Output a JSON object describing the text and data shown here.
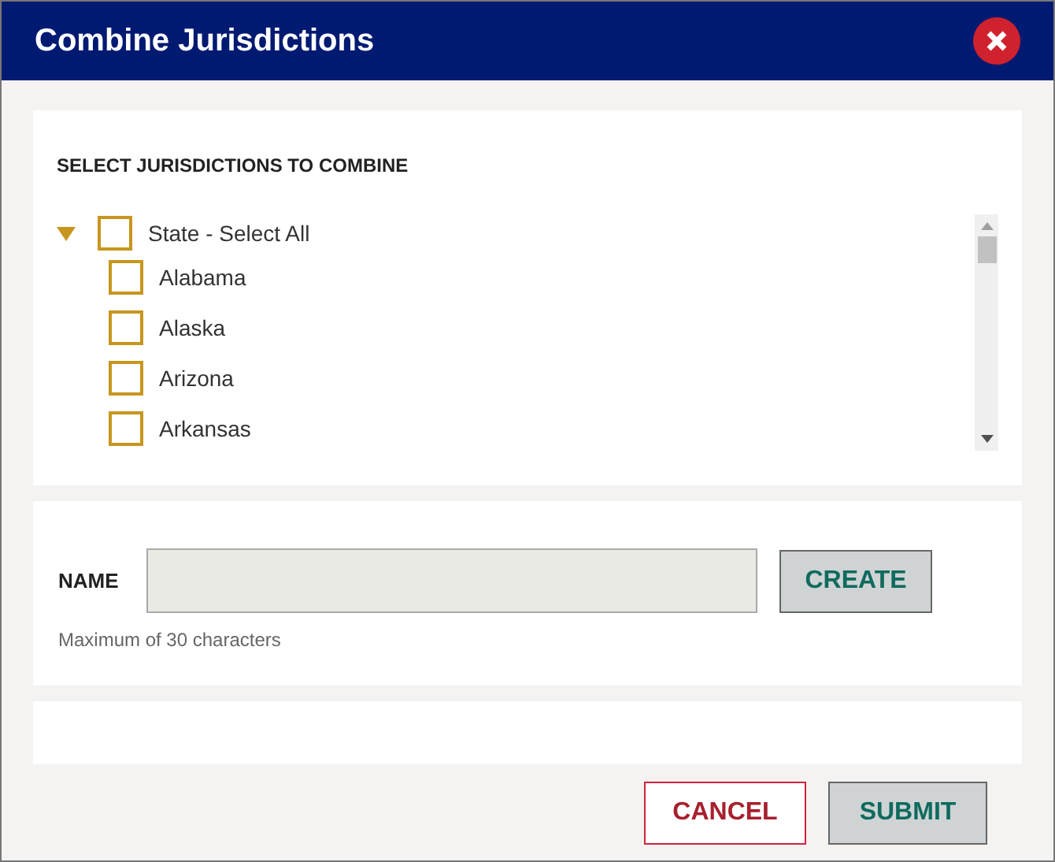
{
  "dialog": {
    "title": "Combine Jurisdictions"
  },
  "select_panel": {
    "heading": "SELECT JURISDICTIONS TO COMBINE",
    "tree": [
      {
        "label": "State - Select All",
        "expanded": true,
        "checked": false,
        "children": [
          {
            "label": "Alabama",
            "checked": false
          },
          {
            "label": "Alaska",
            "checked": false
          },
          {
            "label": "Arizona",
            "checked": false
          },
          {
            "label": "Arkansas",
            "checked": false
          }
        ]
      }
    ]
  },
  "name_panel": {
    "label": "NAME",
    "button": "CREATE",
    "hint": "Maximum of 30 characters"
  },
  "buttons": [
    {
      "label": "CANCEL",
      "kind": "secondary"
    },
    {
      "label": "SUBMIT",
      "kind": "primary"
    }
  ]
}
